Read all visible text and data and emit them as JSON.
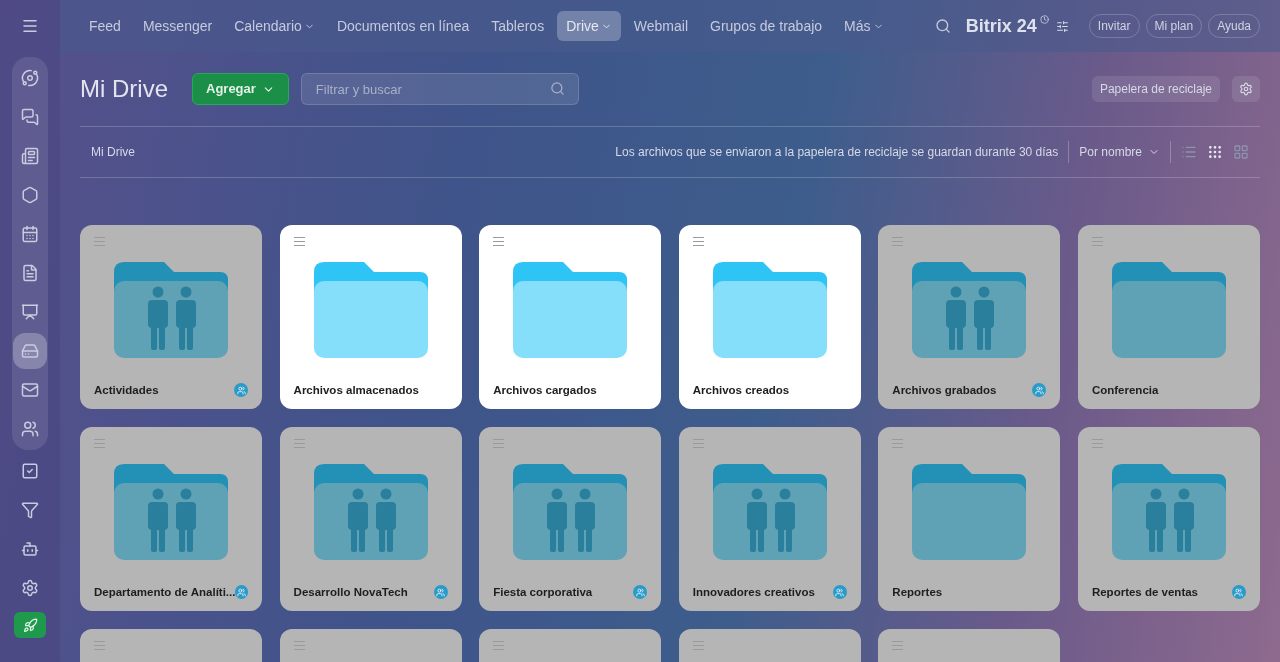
{
  "nav": [
    {
      "label": "Feed",
      "selected": false,
      "has_menu": false
    },
    {
      "label": "Messenger",
      "selected": false,
      "has_menu": false
    },
    {
      "label": "Calendario",
      "selected": false,
      "has_menu": true
    },
    {
      "label": "Documentos en línea",
      "selected": false,
      "has_menu": false
    },
    {
      "label": "Tableros",
      "selected": false,
      "has_menu": false
    },
    {
      "label": "Drive",
      "selected": true,
      "has_menu": true
    },
    {
      "label": "Webmail",
      "selected": false,
      "has_menu": false
    },
    {
      "label": "Grupos de trabajo",
      "selected": false,
      "has_menu": false
    },
    {
      "label": "Más",
      "selected": false,
      "has_menu": true
    }
  ],
  "brand": {
    "name": "Bitrix",
    "number": "24"
  },
  "header_buttons": [
    "Invitar",
    "Mi plan",
    "Ayuda"
  ],
  "sidebar": [
    {
      "selected": false
    },
    {
      "selected": false
    },
    {
      "selected": false
    },
    {
      "selected": false
    },
    {
      "selected": false
    },
    {
      "selected": false
    },
    {
      "selected": false
    },
    {
      "selected": true
    },
    {
      "selected": false
    },
    {
      "selected": false
    },
    {
      "selected": false
    },
    {
      "selected": false
    },
    {
      "selected": false
    },
    {
      "selected": false
    }
  ],
  "page": {
    "title": "Mi Drive",
    "add_button": "Agregar",
    "search": {
      "placeholder": "Filtrar y buscar"
    },
    "trash_button": "Papelera de reciclaje"
  },
  "toolbar": {
    "breadcrumb": "Mi Drive",
    "notice": "Los archivos que se enviaron a la papelera de reciclaje se guardan durante 30 días",
    "sort": "Por nombre",
    "views": [
      {
        "selected": false
      },
      {
        "selected": true
      },
      {
        "selected": false
      }
    ]
  },
  "folders": [
    {
      "name": "Actividades",
      "shared": true,
      "selected": false
    },
    {
      "name": "Archivos almacenados",
      "shared": false,
      "selected": true
    },
    {
      "name": "Archivos cargados",
      "shared": false,
      "selected": true
    },
    {
      "name": "Archivos creados",
      "shared": false,
      "selected": true
    },
    {
      "name": "Archivos grabados",
      "shared": true,
      "selected": false
    },
    {
      "name": "Conferencia",
      "shared": false,
      "selected": false
    },
    {
      "name": "Departamento de Analíti...",
      "shared": true,
      "selected": false
    },
    {
      "name": "Desarrollo NovaTech",
      "shared": true,
      "selected": false
    },
    {
      "name": "Fiesta corporativa",
      "shared": true,
      "selected": false
    },
    {
      "name": "Innovadores creativos",
      "shared": true,
      "selected": false
    },
    {
      "name": "Reportes",
      "shared": false,
      "selected": false
    },
    {
      "name": "Reportes de ventas",
      "shared": true,
      "selected": false
    }
  ],
  "partial_folders": [
    {
      "selected": false
    },
    {
      "selected": false
    },
    {
      "selected": false
    },
    {
      "selected": false
    },
    {
      "selected": false
    }
  ]
}
